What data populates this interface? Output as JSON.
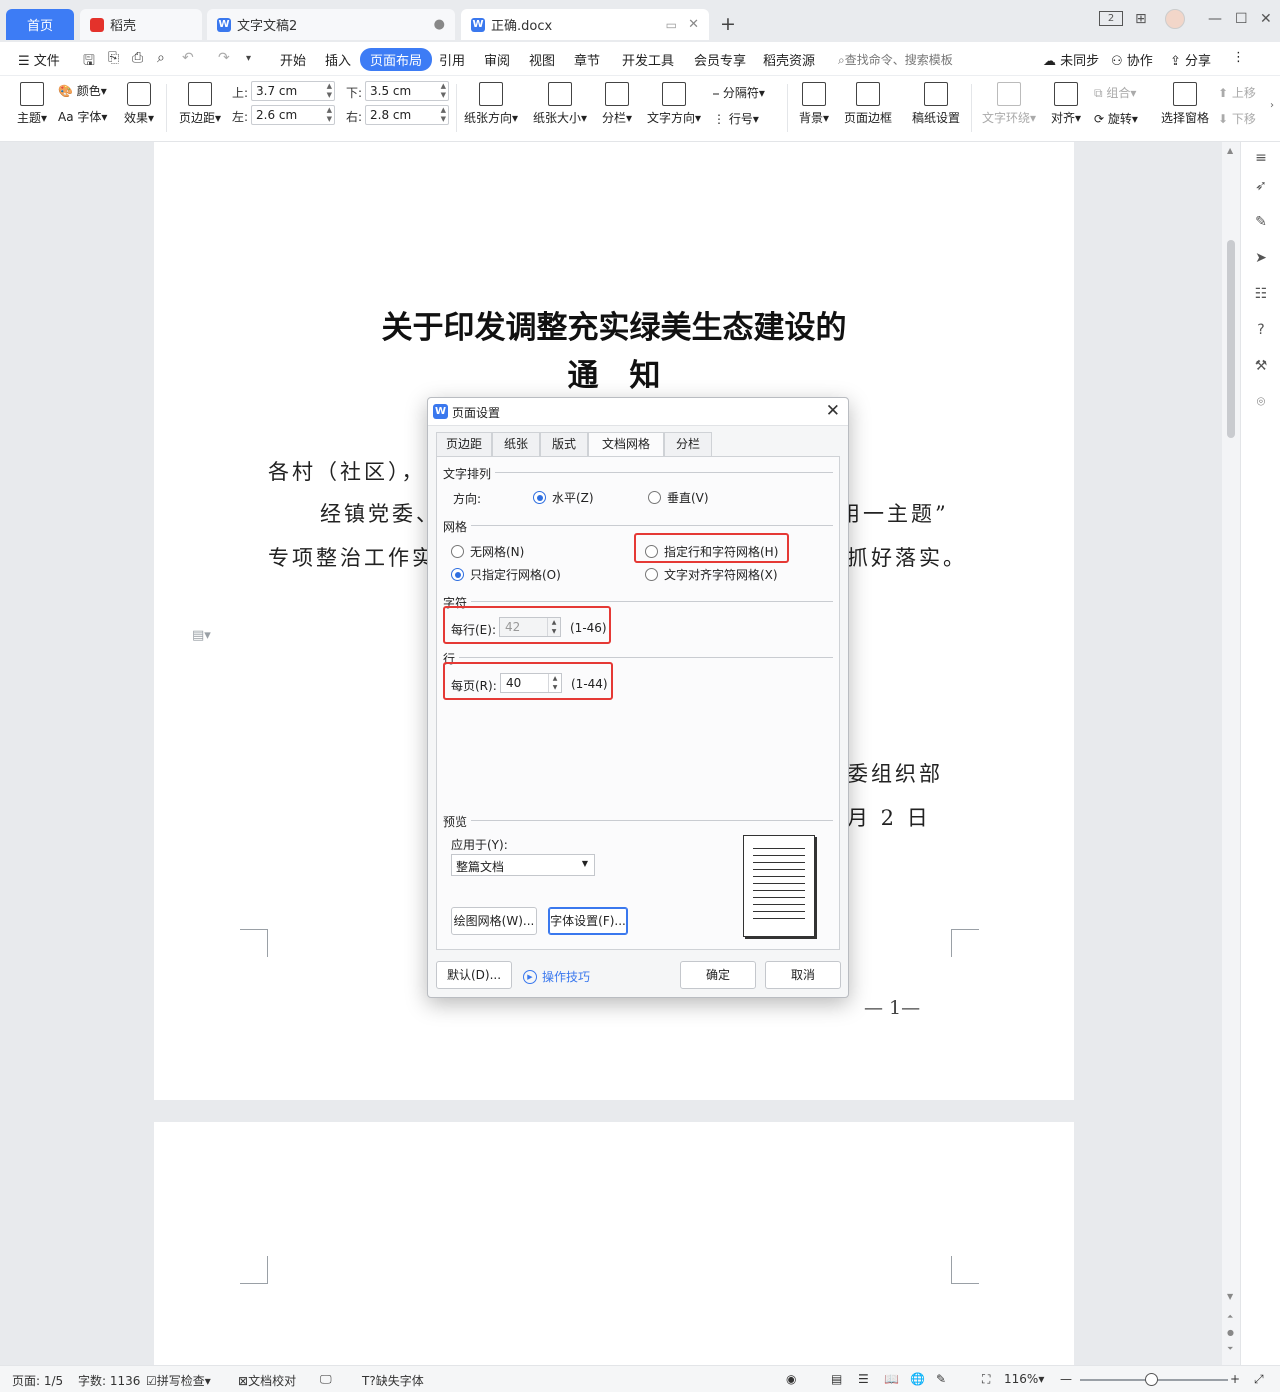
{
  "tabs": [
    {
      "label": "首页"
    },
    {
      "label": "稻壳"
    },
    {
      "label": "文字文稿2"
    },
    {
      "label": "正确.docx"
    }
  ],
  "window_badge": "2",
  "menu": {
    "file": "文件",
    "items": [
      "开始",
      "插入",
      "页面布局",
      "引用",
      "审阅",
      "视图",
      "章节",
      "开发工具",
      "会员专享",
      "稻壳资源"
    ],
    "active": "页面布局",
    "search": "查找命令、搜索模板",
    "sync": "未同步",
    "collab": "协作",
    "share": "分享"
  },
  "ribbon": {
    "theme": "主题",
    "color": "颜色",
    "font": "字体",
    "effect": "效果",
    "margins": "页边距",
    "margin_top_label": "上:",
    "margin_top": "3.7 cm",
    "margin_bottom_label": "下:",
    "margin_bottom": "3.5 cm",
    "margin_left_label": "左:",
    "margin_left": "2.6 cm",
    "margin_right_label": "右:",
    "margin_right": "2.8 cm",
    "orientation": "纸张方向",
    "size": "纸张大小",
    "columns": "分栏",
    "text_direction": "文字方向",
    "breaks": "分隔符",
    "line_numbers": "行号",
    "background": "背景",
    "page_border": "页面边框",
    "manuscript": "稿纸设置",
    "wrap": "文字环绕",
    "align": "对齐",
    "group": "组合",
    "rotate": "旋转",
    "selection_pane": "选择窗格",
    "bring_forward": "上移",
    "send_backward": "下移"
  },
  "document": {
    "title_line1": "关于印发调整充实绿美生态建设的",
    "title_line2": "通　知",
    "salutation": "各村（社区），",
    "body_line1_left": "经镇党委、",
    "body_line1_right": "用一主题”",
    "body_line2_left": "专项整治工作实",
    "body_line2_right": "抓好落实。",
    "sign_org": "委组织部",
    "sign_date": "月 2 日",
    "page_number": "— 1—"
  },
  "dialog": {
    "title": "页面设置",
    "tabs": [
      "页边距",
      "纸张",
      "版式",
      "文档网格",
      "分栏"
    ],
    "active_tab": "文档网格",
    "text_flow_section": "文字排列",
    "direction_label": "方向:",
    "direction_horizontal": "水平(Z)",
    "direction_vertical": "垂直(V)",
    "grid_section": "网格",
    "no_grid": "无网格(N)",
    "line_grid_only": "只指定行网格(O)",
    "line_and_char_grid": "指定行和字符网格(H)",
    "snap_char_grid": "文字对齐字符网格(X)",
    "chars_section": "字符",
    "chars_per_line_label": "每行(E):",
    "chars_per_line": "42",
    "chars_range": "(1-46)",
    "lines_section": "行",
    "lines_per_page_label": "每页(R):",
    "lines_per_page": "40",
    "lines_range": "(1-44)",
    "preview_section": "预览",
    "apply_to_label": "应用于(Y):",
    "apply_to": "整篇文档",
    "drawing_grid_button": "绘图网格(W)...",
    "font_settings_button": "字体设置(F)...",
    "default_button": "默认(D)...",
    "tips_link": "操作技巧",
    "ok_button": "确定",
    "cancel_button": "取消"
  },
  "statusbar": {
    "page": "页面: 1/5",
    "words": "字数: 1136",
    "spell": "拼写检查",
    "proof": "文档校对",
    "missing_font": "缺失字体",
    "zoom": "116%"
  }
}
